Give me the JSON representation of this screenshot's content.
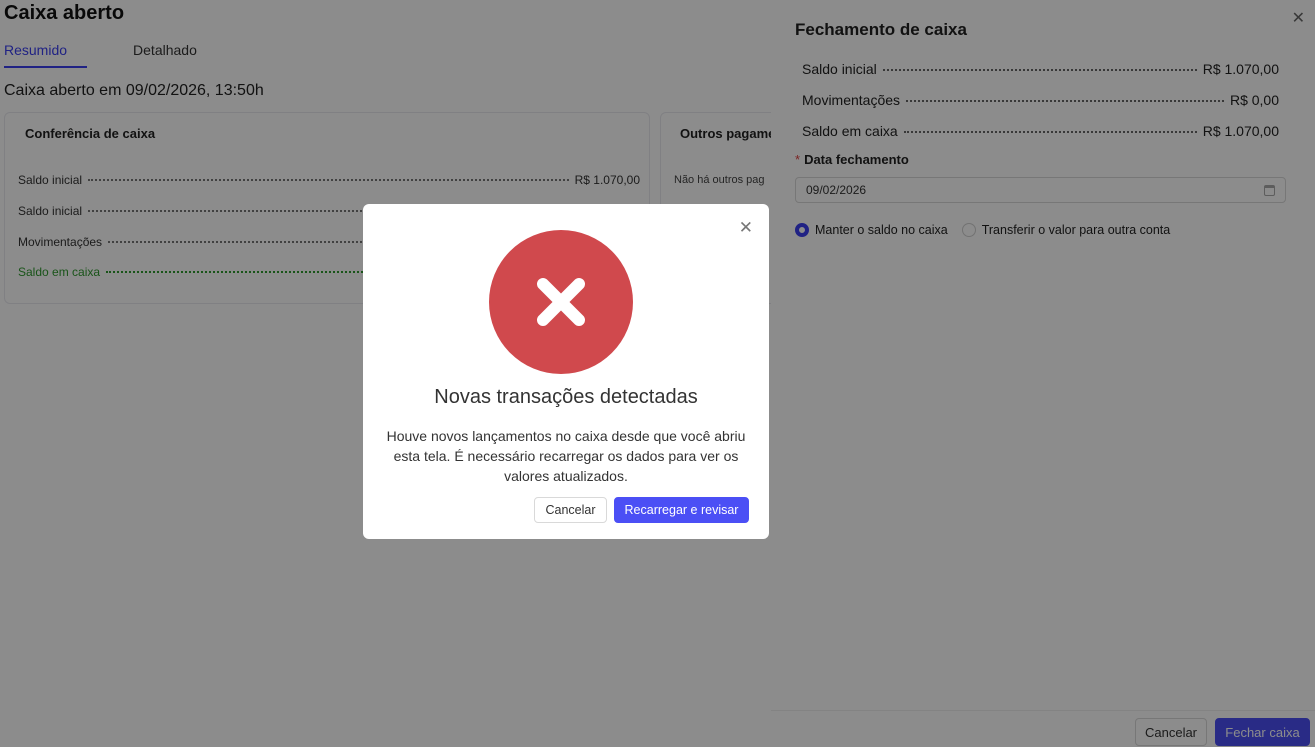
{
  "page": {
    "title": "Caixa aberto",
    "tabs": [
      {
        "label": "Resumido",
        "active": true
      },
      {
        "label": "Detalhado",
        "active": false
      }
    ],
    "opened_at": "Caixa aberto em 09/02/2026, 13:50h"
  },
  "conferencia": {
    "title": "Conferência de caixa",
    "rows": [
      {
        "label": "Saldo inicial",
        "value": "R$ 1.070,00"
      },
      {
        "label": "Saldo inicial",
        "value": ""
      },
      {
        "label": "Movimentações",
        "value": ""
      },
      {
        "label": "Saldo em caixa",
        "value": ""
      }
    ]
  },
  "outros": {
    "title": "Outros pagame",
    "empty": "Não há outros pag"
  },
  "drawer": {
    "title": "Fechamento de caixa",
    "rows": [
      {
        "label": "Saldo inicial",
        "value": "R$ 1.070,00"
      },
      {
        "label": "Movimentações",
        "value": "R$ 0,00"
      },
      {
        "label": "Saldo em caixa",
        "value": "R$ 1.070,00"
      }
    ],
    "date_label": "Data fechamento",
    "required_mark": "*",
    "date_value": "09/02/2026",
    "radio_options": [
      {
        "label": "Manter o saldo no caixa",
        "checked": true
      },
      {
        "label": "Transferir o valor para outra conta",
        "checked": false
      }
    ],
    "cancel_label": "Cancelar",
    "submit_label": "Fechar caixa"
  },
  "modal": {
    "title": "Novas transações detectadas",
    "body": "Houve novos lançamentos no caixa desde que você abriu esta tela. É necessário recarregar os dados para ver os valores atualizados.",
    "cancel_label": "Cancelar",
    "confirm_label": "Recarregar e revisar"
  },
  "colors": {
    "accent": "#4b4ff5",
    "error": "#d0494d",
    "success_text": "#2f9a2f"
  },
  "icons": {
    "close": "close-icon",
    "error": "error-x-icon",
    "calendar": "calendar-icon"
  }
}
